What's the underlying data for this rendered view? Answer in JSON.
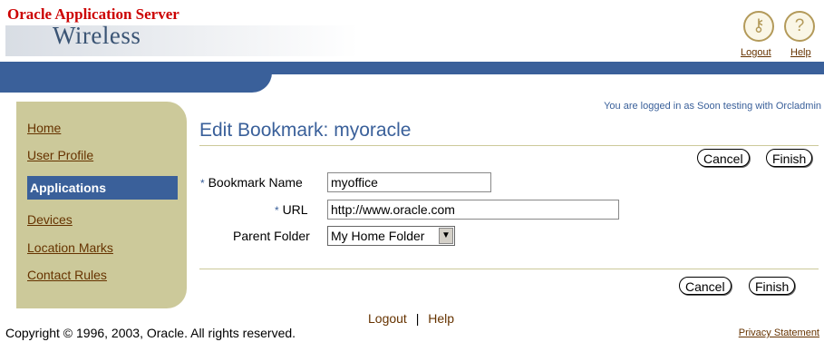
{
  "header": {
    "brand_top": "Oracle Application Server",
    "brand_product": "Wireless",
    "logout_label": "Logout",
    "help_label": "Help",
    "logout_icon": "key-icon",
    "help_icon": "question-icon"
  },
  "nav": {
    "items": [
      "Home",
      "User Profile",
      "Applications",
      "Devices",
      "Location Marks",
      "Contact Rules"
    ],
    "active": "Applications"
  },
  "login_message": "You are logged in as Soon testing with Orcladmin",
  "page_title": "Edit Bookmark: myoracle",
  "buttons": {
    "cancel": "Cancel",
    "finish": "Finish"
  },
  "form": {
    "required_marker": "*",
    "bookmark_name_label": "Bookmark Name",
    "bookmark_name_value": "myoffice",
    "url_label": "URL",
    "url_value": "http://www.oracle.com",
    "parent_folder_label": "Parent Folder",
    "parent_folder_value": "My Home Folder"
  },
  "footer": {
    "logout": "Logout",
    "separator": "|",
    "help": "Help",
    "copyright": "Copyright © 1996, 2003, Oracle. All rights reserved.",
    "privacy": "Privacy Statement"
  },
  "colors": {
    "brand_red": "#cc0000",
    "bar_blue": "#3a609a",
    "nav_tan": "#ccc99a",
    "link_brown": "#663300"
  }
}
